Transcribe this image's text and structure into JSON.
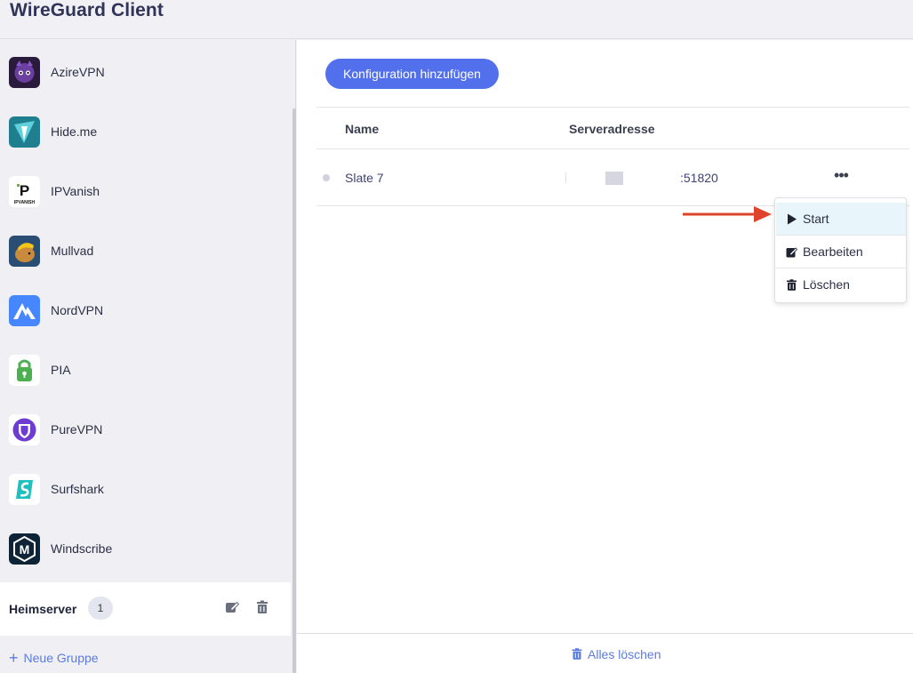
{
  "app": {
    "title": "WireGuard Client"
  },
  "sidebar": {
    "providers": [
      {
        "name": "AzireVPN",
        "icon": "azirevpn-logo-icon",
        "color": "#2a1b3d"
      },
      {
        "name": "Hide.me",
        "icon": "hideme-logo-icon",
        "color": "#1f7f8f"
      },
      {
        "name": "IPVanish",
        "icon": "ipvanish-logo-icon",
        "color": "#ffffff"
      },
      {
        "name": "Mullvad",
        "icon": "mullvad-logo-icon",
        "color": "#294d73"
      },
      {
        "name": "NordVPN",
        "icon": "nordvpn-logo-icon",
        "color": "#4687ff"
      },
      {
        "name": "PIA",
        "icon": "pia-logo-icon",
        "color": "#ffffff"
      },
      {
        "name": "PureVPN",
        "icon": "purevpn-logo-icon",
        "color": "#ffffff"
      },
      {
        "name": "Surfshark",
        "icon": "surfshark-logo-icon",
        "color": "#ffffff"
      },
      {
        "name": "Windscribe",
        "icon": "windscribe-logo-icon",
        "color": "#0f2336"
      }
    ],
    "group": {
      "name": "Heimserver",
      "count": "1",
      "edit_icon": "edit-icon",
      "delete_icon": "trash-icon"
    },
    "new_group": {
      "plus": "+",
      "label": "Neue Gruppe"
    }
  },
  "main": {
    "add_button": "Konfiguration hinzufügen",
    "table": {
      "columns": [
        "Name",
        "Serveradresse"
      ],
      "rows": [
        {
          "name": "Slate 7",
          "port": ":51820",
          "more": "•••"
        }
      ]
    },
    "context_menu": {
      "items": [
        {
          "label": "Start",
          "icon": "play-icon"
        },
        {
          "label": "Bearbeiten",
          "icon": "edit-icon"
        },
        {
          "label": "Löschen",
          "icon": "trash-icon"
        }
      ]
    },
    "footer": {
      "clear_all": "Alles löschen",
      "icon": "trash-icon"
    }
  },
  "colors": {
    "accent": "#5370ec",
    "link": "#5b7be0",
    "arrow": "#e0432b",
    "menu_active": "#e8f5fb"
  }
}
